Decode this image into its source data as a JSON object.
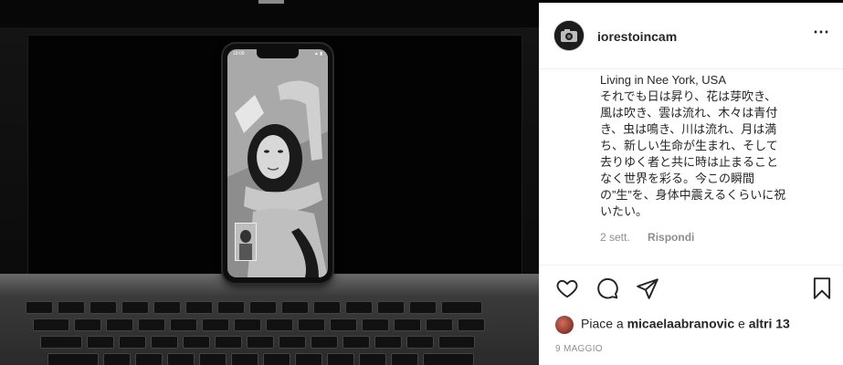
{
  "post": {
    "username": "iorestoincam",
    "more_icon": "⋯",
    "caption_lines": [
      "Living in Nee York, USA",
      "それでも日は昇り、花は芽吹き、",
      "風は吹き、雲は流れ、木々は青付",
      "き、虫は鳴き、川は流れ、月は満",
      "ち、新しい生命が生まれ、そして",
      "去りゆく者と共に時は止まること",
      "なく世界を彩る。今この瞬間",
      "の”生”を、身体中震えるくらいに祝",
      "いたい。"
    ],
    "comment_time": "2 sett.",
    "reply_label": "Rispondi",
    "likes_prefix": "Piace a",
    "likes_user": "micaelaabranovic",
    "likes_joiner": "e",
    "likes_others": "altri 13",
    "date": "9 MAGGIO"
  },
  "phone": {
    "time": "19:09",
    "status": "▲ ▮"
  },
  "icons": {
    "like": "heart-icon",
    "comment": "comment-icon",
    "share": "send-icon",
    "save": "bookmark-icon"
  },
  "colors": {
    "text": "#262626",
    "muted": "#8e8e8e",
    "border": "#efefef"
  }
}
